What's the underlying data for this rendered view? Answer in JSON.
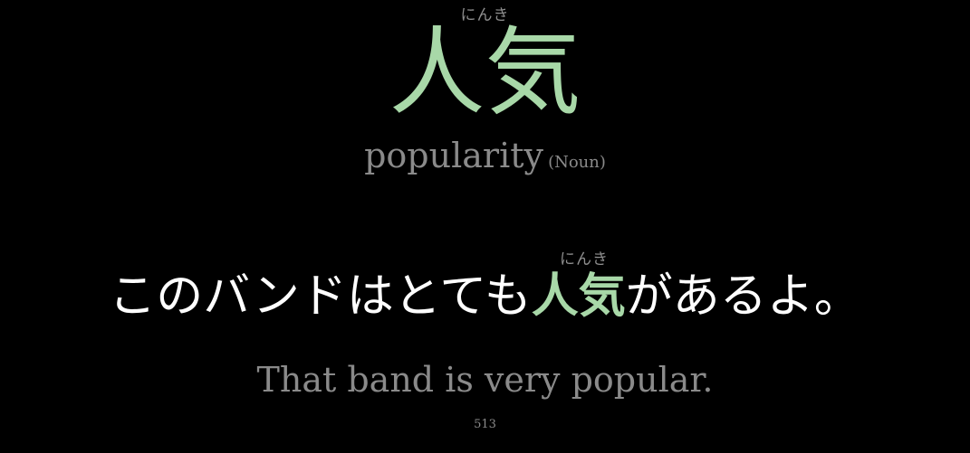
{
  "word": {
    "reading": "にんき",
    "kanji": "人気",
    "meaning": "popularity",
    "part_of_speech": "(Noun)"
  },
  "sentence": {
    "reading": "にんき",
    "before": "このバンドはとても",
    "highlight": "人気",
    "after": "があるよ。",
    "translation": "That band is very popular."
  },
  "card_number": "513",
  "colors": {
    "background": "#000000",
    "accent": "#a8d8a8",
    "muted": "#8a8a8a",
    "text": "#ffffff"
  }
}
